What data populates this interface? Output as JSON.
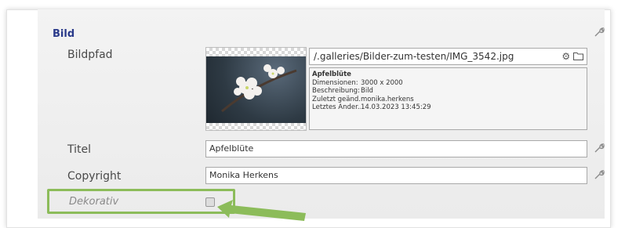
{
  "section": {
    "title": "Bild"
  },
  "bildpfad": {
    "label": "Bildpfad",
    "path_value": "/.galleries/Bilder-zum-testen/IMG_3542.jpg",
    "info": {
      "name": "Apfelblüte",
      "rows": [
        {
          "key": "Dimensionen:",
          "value": "3000 x 2000"
        },
        {
          "key": "Beschreibung:",
          "value": "Bild"
        },
        {
          "key": "Zuletzt geänd...",
          "value": "monika.herkens"
        },
        {
          "key": "Letztes Änder...",
          "value": "14.03.2023 13:45:29"
        }
      ]
    }
  },
  "titel": {
    "label": "Titel",
    "value": "Apfelblüte"
  },
  "copyright": {
    "label": "Copyright",
    "value": "Monika Herkens"
  },
  "dekorativ": {
    "label": "Dekorativ",
    "checked": false
  },
  "colors": {
    "title": "#2a3a8a",
    "highlight": "#8cbc5a"
  },
  "icons": {
    "section_action": "wrench-icon",
    "path_actions": [
      "gear-icon",
      "folder-icon"
    ]
  }
}
